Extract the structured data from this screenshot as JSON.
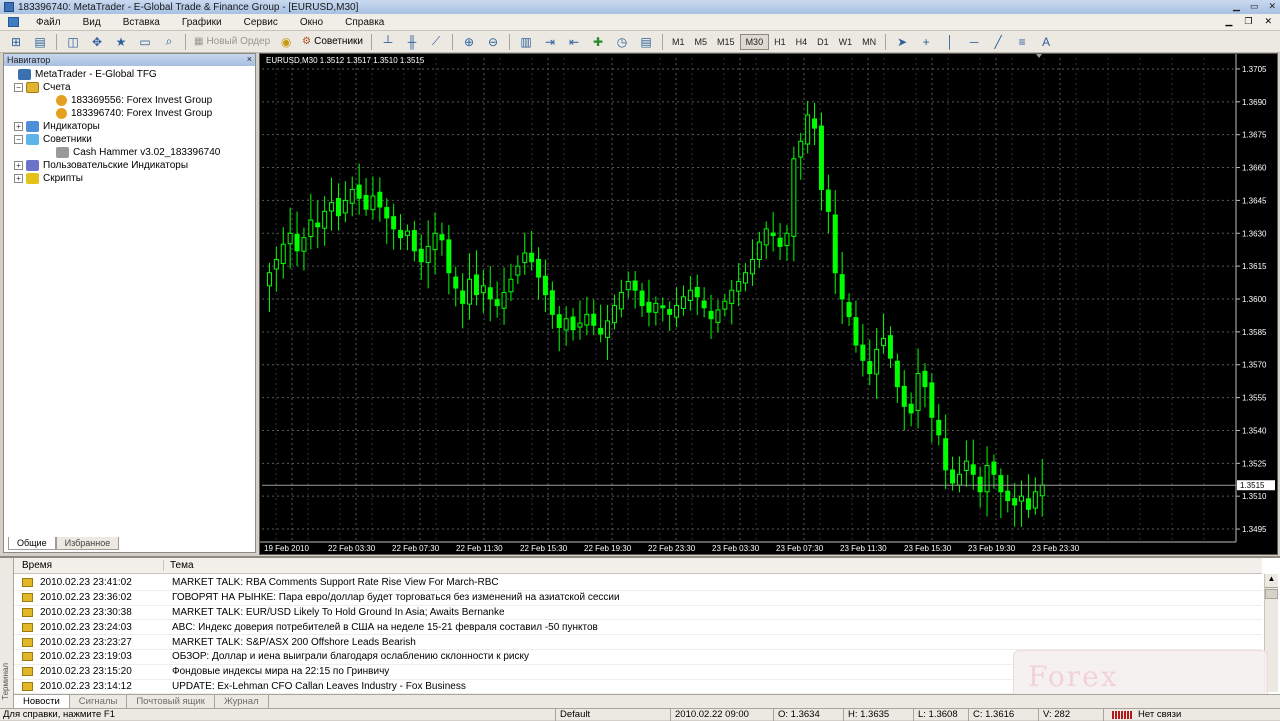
{
  "window": {
    "title": "183396740: MetaTrader - E-Global Trade & Finance Group - [EURUSD,M30]"
  },
  "menu": {
    "items": [
      "Файл",
      "Вид",
      "Вставка",
      "Графики",
      "Сервис",
      "Окно",
      "Справка"
    ]
  },
  "toolbar": {
    "new_order_label": "Новый Ордер",
    "experts_label": "Советники",
    "timeframes": [
      "M1",
      "M5",
      "M15",
      "M30",
      "H1",
      "H4",
      "D1",
      "W1",
      "MN"
    ],
    "active_timeframe": "M30"
  },
  "navigator": {
    "title": "Навигатор",
    "close": "×",
    "root": "MetaTrader - E-Global TFG",
    "accounts": "Счета",
    "account1": "183369556: Forex Invest Group",
    "account2": "183396740: Forex Invest Group",
    "indicators": "Индикаторы",
    "experts": "Советники",
    "expert1": "Cash Hammer v3.02_183396740",
    "custom_indicators": "Пользовательские Индикаторы",
    "scripts": "Скрипты",
    "tab_common": "Общие",
    "tab_favorites": "Избранное"
  },
  "chart": {
    "label": "EURUSD,M30  1.3512  1.3517  1.3510  1.3515",
    "bg": "#000000",
    "candle_color": "#00ff00",
    "grid_color": "#5a5a5a"
  },
  "chart_data": {
    "type": "candlestick",
    "title": "EURUSD,M30  1.3512  1.3517  1.3510  1.3515",
    "symbol": "EURUSD",
    "timeframe": "M30",
    "last_bar": {
      "open": 1.3512,
      "high": 1.3517,
      "low": 1.351,
      "close": 1.3515
    },
    "current_price": 1.3515,
    "ylim": [
      1.349,
      1.371
    ],
    "y_ticks": [
      "1.3705",
      "1.3690",
      "1.3675",
      "1.3660",
      "1.3645",
      "1.3630",
      "1.3615",
      "1.3600",
      "1.3585",
      "1.3570",
      "1.3555",
      "1.3540",
      "1.3525",
      "1.3510",
      "1.3495"
    ],
    "x_ticks": [
      "19 Feb 2010",
      "22 Feb 03:30",
      "22 Feb 07:30",
      "22 Feb 11:30",
      "22 Feb 15:30",
      "22 Feb 19:30",
      "22 Feb 23:30",
      "23 Feb 03:30",
      "23 Feb 07:30",
      "23 Feb 11:30",
      "23 Feb 15:30",
      "23 Feb 19:30",
      "23 Feb 23:30"
    ],
    "grid": true,
    "closes": [
      1.3612,
      1.3618,
      1.3625,
      1.363,
      1.3622,
      1.3628,
      1.3636,
      1.3633,
      1.364,
      1.3644,
      1.3638,
      1.3645,
      1.365,
      1.3646,
      1.3641,
      1.3647,
      1.3642,
      1.3637,
      1.3632,
      1.3628,
      1.3631,
      1.3622,
      1.3617,
      1.3624,
      1.363,
      1.3627,
      1.3612,
      1.3605,
      1.3598,
      1.3609,
      1.3602,
      1.3606,
      1.36,
      1.3597,
      1.3603,
      1.3609,
      1.3615,
      1.3621,
      1.3617,
      1.361,
      1.3602,
      1.3593,
      1.3587,
      1.3591,
      1.3586,
      1.3589,
      1.3593,
      1.3588,
      1.3584,
      1.359,
      1.3597,
      1.3603,
      1.3608,
      1.3604,
      1.3597,
      1.3594,
      1.3598,
      1.3596,
      1.3593,
      1.3597,
      1.3601,
      1.3604,
      1.3601,
      1.3596,
      1.3591,
      1.3595,
      1.3599,
      1.3604,
      1.3608,
      1.3612,
      1.3618,
      1.3626,
      1.3632,
      1.3629,
      1.3624,
      1.363,
      1.3664,
      1.3672,
      1.3684,
      1.3678,
      1.365,
      1.364,
      1.3612,
      1.36,
      1.3592,
      1.3579,
      1.3572,
      1.3566,
      1.3577,
      1.3582,
      1.3573,
      1.356,
      1.3551,
      1.3548,
      1.3566,
      1.356,
      1.3546,
      1.3538,
      1.3522,
      1.3516,
      1.352,
      1.3526,
      1.352,
      1.3512,
      1.3524,
      1.352,
      1.3512,
      1.3508,
      1.3506,
      1.351,
      1.3504,
      1.3512,
      1.3515
    ]
  },
  "terminal": {
    "side_label": "Терминал",
    "col_time": "Время",
    "col_subject": "Тема",
    "rows": [
      {
        "time": "2010.02.23 23:41:02",
        "subject": "MARKET TALK: RBA Comments Support Rate Rise View For March-RBC"
      },
      {
        "time": "2010.02.23 23:36:02",
        "subject": "ГОВОРЯТ НА РЫНКЕ: Пара евро/доллар будет торговаться без изменений на азиатской сессии"
      },
      {
        "time": "2010.02.23 23:30:38",
        "subject": "MARKET TALK: EUR/USD Likely To Hold Ground In Asia; Awaits Bernanke"
      },
      {
        "time": "2010.02.23 23:24:03",
        "subject": "ABC: Индекс доверия потребителей в США на неделе 15-21 февраля составил -50 пунктов"
      },
      {
        "time": "2010.02.23 23:23:27",
        "subject": "MARKET TALK: S&P/ASX 200 Offshore Leads Bearish"
      },
      {
        "time": "2010.02.23 23:19:03",
        "subject": "ОБЗОР: Доллар и иена выиграли благодаря ослаблению склонности к риску"
      },
      {
        "time": "2010.02.23 23:15:20",
        "subject": "Фондовые индексы мира на 22:15 по Гринвичу"
      },
      {
        "time": "2010.02.23 23:14:12",
        "subject": "UPDATE: Ex-Lehman CFO Callan Leaves Industry - Fox Business"
      }
    ],
    "tabs": [
      "Новости",
      "Сигналы",
      "Почтовый ящик",
      "Журнал"
    ],
    "watermark": "Forex"
  },
  "status": {
    "help": "Для справки, нажмите F1",
    "profile": "Default",
    "datetime": "2010.02.22 09:00",
    "open": "O: 1.3634",
    "high": "H: 1.3635",
    "low": "L: 1.3608",
    "close": "C: 1.3616",
    "volume": "V: 282",
    "connection": "Нет связи"
  }
}
